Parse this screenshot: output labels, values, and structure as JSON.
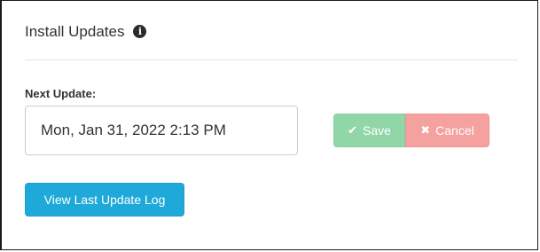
{
  "panel": {
    "title": "Install Updates",
    "info_icon": "info-circle",
    "info_glyph": "i"
  },
  "form": {
    "next_update_label": "Next Update:",
    "next_update_value": "Mon, Jan 31, 2022 2:13 PM"
  },
  "actions": {
    "save_label": "Save",
    "save_icon": "checkmark",
    "save_glyph": "✔",
    "cancel_label": "Cancel",
    "cancel_icon": "x-mark",
    "cancel_glyph": "✖",
    "view_log_label": "View Last Update Log"
  },
  "colors": {
    "save_bg": "#91d6a7",
    "cancel_bg": "#f4a19f",
    "primary_bg": "#1fa9d8"
  }
}
